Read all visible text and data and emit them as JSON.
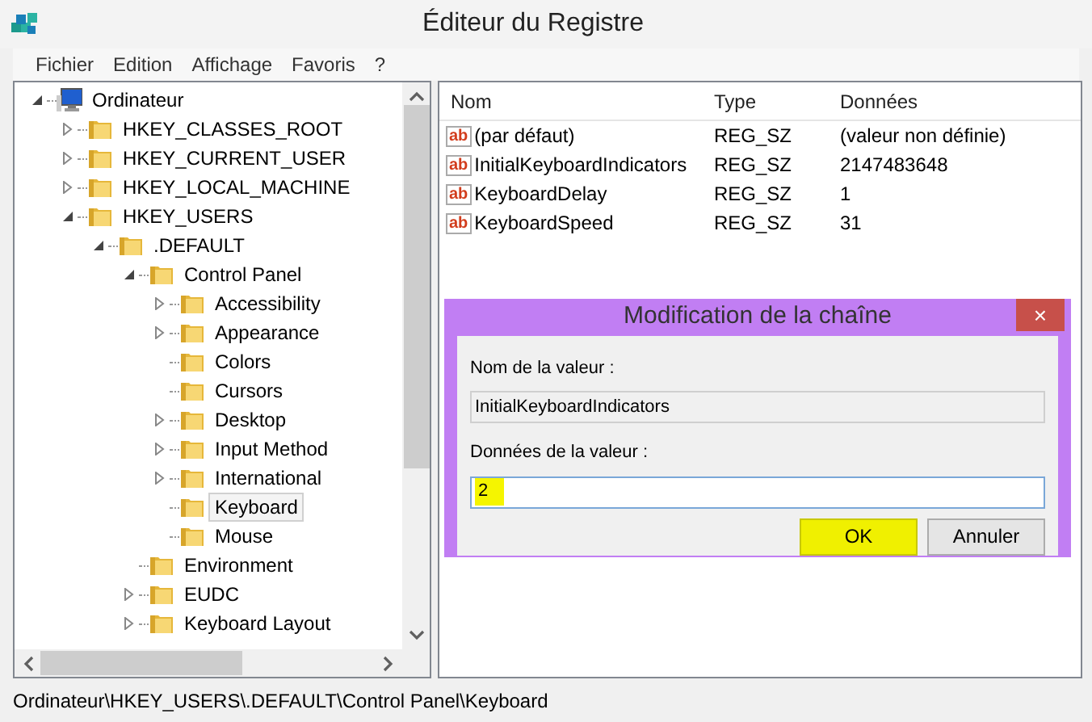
{
  "window": {
    "title": "Éditeur du Registre"
  },
  "menu": [
    "Fichier",
    "Edition",
    "Affichage",
    "Favoris",
    "?"
  ],
  "tree": [
    {
      "label": "Ordinateur",
      "kind": "computer",
      "expandable": true,
      "expanded": true,
      "selected": false,
      "children": [
        {
          "label": "HKEY_CLASSES_ROOT",
          "kind": "folder",
          "expandable": true,
          "expanded": false,
          "selected": false
        },
        {
          "label": "HKEY_CURRENT_USER",
          "kind": "folder",
          "expandable": true,
          "expanded": false,
          "selected": false
        },
        {
          "label": "HKEY_LOCAL_MACHINE",
          "kind": "folder",
          "expandable": true,
          "expanded": false,
          "selected": false
        },
        {
          "label": "HKEY_USERS",
          "kind": "folder",
          "expandable": true,
          "expanded": true,
          "selected": false,
          "children": [
            {
              "label": ".DEFAULT",
              "kind": "folder",
              "expandable": true,
              "expanded": true,
              "selected": false,
              "children": [
                {
                  "label": "Control Panel",
                  "kind": "folder",
                  "expandable": true,
                  "expanded": true,
                  "selected": false,
                  "children": [
                    {
                      "label": "Accessibility",
                      "kind": "folder",
                      "expandable": true,
                      "expanded": false,
                      "selected": false
                    },
                    {
                      "label": "Appearance",
                      "kind": "folder",
                      "expandable": true,
                      "expanded": false,
                      "selected": false
                    },
                    {
                      "label": "Colors",
                      "kind": "folder",
                      "expandable": false,
                      "selected": false
                    },
                    {
                      "label": "Cursors",
                      "kind": "folder",
                      "expandable": false,
                      "selected": false
                    },
                    {
                      "label": "Desktop",
                      "kind": "folder",
                      "expandable": true,
                      "expanded": false,
                      "selected": false
                    },
                    {
                      "label": "Input Method",
                      "kind": "folder",
                      "expandable": true,
                      "expanded": false,
                      "selected": false
                    },
                    {
                      "label": "International",
                      "kind": "folder",
                      "expandable": true,
                      "expanded": false,
                      "selected": false
                    },
                    {
                      "label": "Keyboard",
                      "kind": "folder",
                      "expandable": false,
                      "selected": true
                    },
                    {
                      "label": "Mouse",
                      "kind": "folder",
                      "expandable": false,
                      "selected": false
                    }
                  ]
                },
                {
                  "label": "Environment",
                  "kind": "folder",
                  "expandable": false,
                  "selected": false
                },
                {
                  "label": "EUDC",
                  "kind": "folder",
                  "expandable": true,
                  "expanded": false,
                  "selected": false
                },
                {
                  "label": "Keyboard Layout",
                  "kind": "folder",
                  "expandable": true,
                  "expanded": false,
                  "selected": false
                }
              ]
            }
          ]
        }
      ]
    }
  ],
  "values": {
    "columns": [
      "Nom",
      "Type",
      "Données"
    ],
    "rows": [
      {
        "icon_text": "ab",
        "name": "(par défaut)",
        "type": "REG_SZ",
        "data": "(valeur non définie)"
      },
      {
        "icon_text": "ab",
        "name": "InitialKeyboardIndicators",
        "type": "REG_SZ",
        "data": "2147483648"
      },
      {
        "icon_text": "ab",
        "name": "KeyboardDelay",
        "type": "REG_SZ",
        "data": "1"
      },
      {
        "icon_text": "ab",
        "name": "KeyboardSpeed",
        "type": "REG_SZ",
        "data": "31"
      }
    ]
  },
  "dialog": {
    "title": "Modification de la chaîne",
    "close": "×",
    "name_label": "Nom de la valeur :",
    "name_value": "InitialKeyboardIndicators",
    "data_label": "Données de la valeur :",
    "data_value": "2",
    "data_highlighted": true,
    "buttons": [
      {
        "label": "OK",
        "highlighted": true
      },
      {
        "label": "Annuler",
        "highlighted": false
      }
    ]
  },
  "status_bar": "Ordinateur\\HKEY_USERS\\.DEFAULT\\Control Panel\\Keyboard"
}
